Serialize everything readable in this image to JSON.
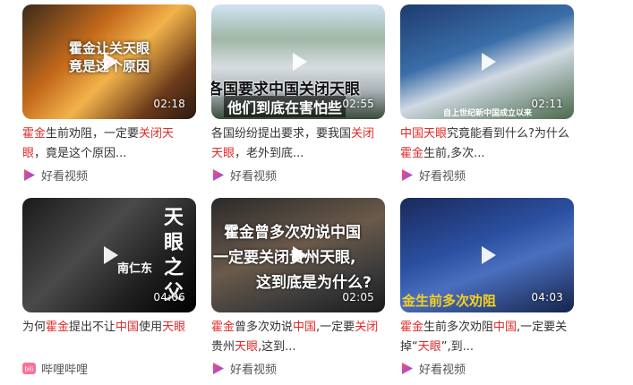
{
  "videos": [
    {
      "duration": "02:18",
      "overlay": [
        "霍金让关天眼",
        "竟是这个原因"
      ],
      "title": [
        {
          "t": "霍金",
          "h": true
        },
        {
          "t": "生前劝阻，一定要",
          "h": false
        },
        {
          "t": "关闭天眼",
          "h": true
        },
        {
          "t": "，竟是这个原因...",
          "h": false
        }
      ],
      "source": "好看视频",
      "source_icon": "haokan-play-icon"
    },
    {
      "duration": "02:55",
      "overlay": [
        "各国要求中国关闭天眼",
        "他们到底在害怕些"
      ],
      "title": [
        {
          "t": "各国纷纷提出要求，要我国",
          "h": false
        },
        {
          "t": "关闭天眼",
          "h": true
        },
        {
          "t": "，老外到底...",
          "h": false
        }
      ],
      "source": "好看视频",
      "source_icon": "haokan-play-icon"
    },
    {
      "duration": "02:11",
      "overlay": [
        "自上世纪新中国成立以来"
      ],
      "title": [
        {
          "t": "中国天眼",
          "h": true
        },
        {
          "t": "究竟能看到什么?为什么",
          "h": false
        },
        {
          "t": "霍金",
          "h": true
        },
        {
          "t": "生前,多次...",
          "h": false
        }
      ],
      "source": "好看视频",
      "source_icon": "haokan-play-icon"
    },
    {
      "duration": "04:06",
      "overlay": [
        "天",
        "眼",
        "之",
        "父",
        "南仁东"
      ],
      "title": [
        {
          "t": "为何",
          "h": false
        },
        {
          "t": "霍金",
          "h": true
        },
        {
          "t": "提出不让",
          "h": false
        },
        {
          "t": "中国",
          "h": true
        },
        {
          "t": "使用",
          "h": false
        },
        {
          "t": "天眼",
          "h": true
        }
      ],
      "source": "哔哩哔哩",
      "source_icon": "bilibili-icon"
    },
    {
      "duration": "02:05",
      "overlay": [
        "霍金曾多次劝说中国",
        "一定要关闭贵州天眼,",
        "这到底是为什么?"
      ],
      "title": [
        {
          "t": "霍金",
          "h": true
        },
        {
          "t": "曾多次劝说",
          "h": false
        },
        {
          "t": "中国",
          "h": true
        },
        {
          "t": ",一定要",
          "h": false
        },
        {
          "t": "关闭",
          "h": true
        },
        {
          "t": "贵州",
          "h": false
        },
        {
          "t": "天眼",
          "h": true
        },
        {
          "t": ",这到...",
          "h": false
        }
      ],
      "source": "好看视频",
      "source_icon": "haokan-play-icon"
    },
    {
      "duration": "04:03",
      "overlay": [
        "金生前多次劝阻"
      ],
      "title": [
        {
          "t": "霍金",
          "h": true
        },
        {
          "t": "生前多次劝阻",
          "h": false
        },
        {
          "t": "中国",
          "h": true
        },
        {
          "t": ",一定要关掉“",
          "h": false
        },
        {
          "t": "天眼",
          "h": true
        },
        {
          "t": "”,到...",
          "h": false
        }
      ],
      "source": "好看视频",
      "source_icon": "haokan-play-icon"
    }
  ],
  "colors": {
    "highlight": "#e02b2b",
    "text": "#333333",
    "source": "#555555",
    "haokan": "#7c4dff"
  }
}
